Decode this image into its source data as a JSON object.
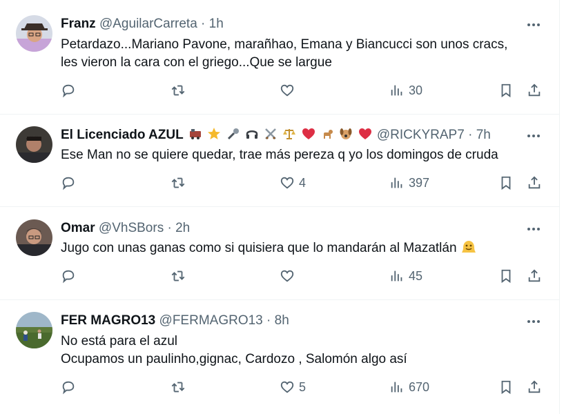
{
  "tweets": [
    {
      "name": "Franz",
      "handle": "@AguilarCarreta",
      "dot": "·",
      "time": "1h",
      "lines": [
        "Petardazo...Mariano Pavone, marañhao, Emana y Biancucci son unos cracs,",
        "les vieron la cara con el griego...Que se largue"
      ],
      "likes": "",
      "views": "30"
    },
    {
      "name": "El Licenciado AZUL",
      "emojis": [
        "train-emoji",
        "star-emoji",
        "microphone-emoji",
        "headphones-emoji",
        "crossed-swords-emoji",
        "scales-emoji",
        "heart-emoji",
        "dog-emoji",
        "dog-face-emoji",
        "heart-emoji"
      ],
      "handle": "@RICKYRAP7",
      "dot": "·",
      "time": "7h",
      "lines": [
        "Ese Man no se quiere quedar, trae más pereza q yo los domingos de cruda"
      ],
      "likes": "4",
      "views": "397"
    },
    {
      "name": "Omar",
      "handle": "@VhSBors",
      "dot": "·",
      "time": "2h",
      "lines": [
        "Jugo con unas ganas como si quisiera que lo mandarán al Mazatlán"
      ],
      "line_emoji": "melting-face-emoji",
      "likes": "",
      "views": "45"
    },
    {
      "name": "FER MAGRO13",
      "handle": "@FERMAGRO13",
      "dot": "·",
      "time": "8h",
      "lines": [
        "No está para el azul",
        "Ocupamos un paulinho,gignac, Cardozo , Salomón algo así"
      ],
      "likes": "5",
      "views": "670"
    }
  ],
  "icons": {
    "reply": "reply-icon",
    "retweet": "retweet-icon",
    "like": "heart-icon",
    "views": "views-chart-icon",
    "bookmark": "bookmark-icon",
    "share": "share-icon",
    "more": "more-options-icon"
  },
  "colors": {
    "secondary_text": "#536471",
    "primary_text": "#0f1419",
    "divider": "#eff3f4"
  }
}
